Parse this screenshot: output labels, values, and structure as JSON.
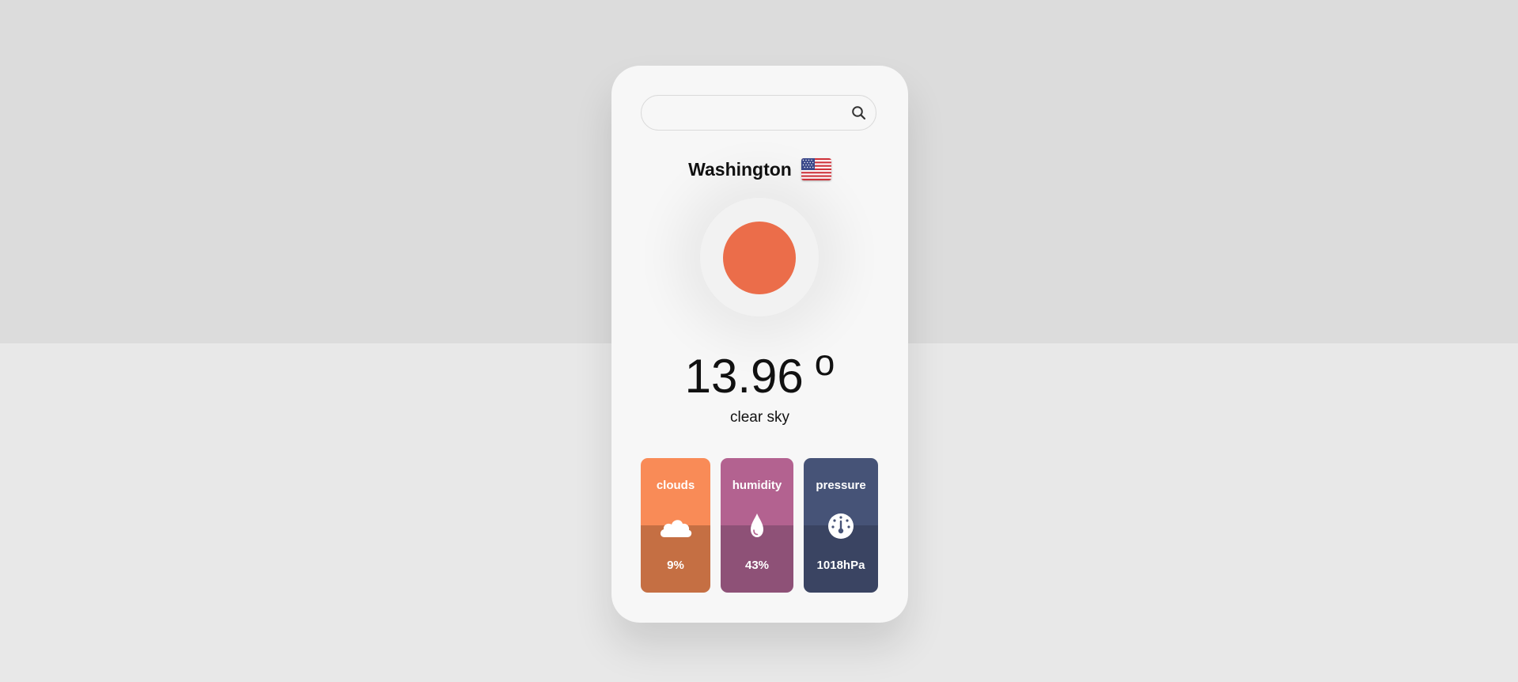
{
  "search": {
    "value": "",
    "placeholder": ""
  },
  "location": {
    "city": "Washington",
    "flag_icon": "us-flag-icon"
  },
  "weather": {
    "icon": "sun-icon",
    "temperature": "13.96",
    "degree_symbol": "o",
    "description": "clear sky"
  },
  "stats": [
    {
      "label": "clouds",
      "value": "9%",
      "icon": "cloud-icon",
      "color_top": "#f98b57",
      "color_bottom": "#c56f43"
    },
    {
      "label": "humidity",
      "value": "43%",
      "icon": "water-drop-icon",
      "color_top": "#b36290",
      "color_bottom": "#8e5177"
    },
    {
      "label": "pressure",
      "value": "1018hPa",
      "icon": "gauge-icon",
      "color_top": "#465377",
      "color_bottom": "#3a4462"
    }
  ],
  "colors": {
    "sun": "#eb6d4a",
    "card_bg": "#f7f7f7",
    "page_bg_top": "#dcdcdc",
    "page_bg_bottom": "#e8e8e8"
  }
}
